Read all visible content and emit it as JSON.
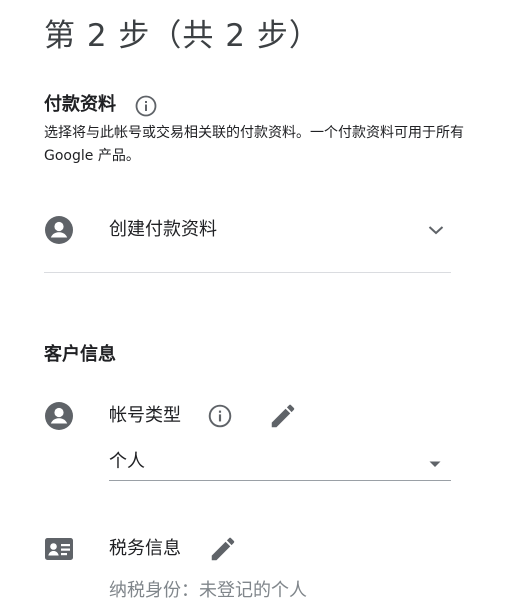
{
  "page": {
    "step_title": "第 2 步（共 2 步）"
  },
  "payment_profile": {
    "title": "付款资料",
    "info_icon": "info-icon",
    "description": "选择将与此帐号或交易相关联的付款资料。一个付款资料可用于所有 Google 产品。",
    "selector": {
      "icon": "account-circle-icon",
      "value": "创建付款资料",
      "dropdown_icon": "chevron-down-icon"
    }
  },
  "customer_info": {
    "title": "客户信息",
    "account_type": {
      "icon": "account-circle-icon",
      "label": "帐号类型",
      "info_icon": "info-icon",
      "edit_icon": "pencil-icon",
      "selected": "个人",
      "dropdown_icon": "arrow-drop-down-icon"
    },
    "tax_info": {
      "icon": "contact-card-icon",
      "label": "税务信息",
      "edit_icon": "pencil-icon",
      "value": "纳税身份：未登记的个人"
    }
  },
  "colors": {
    "icon_gray": "#5f6368",
    "text_primary": "#202124",
    "text_secondary": "#80868b",
    "divider": "#dadce0"
  }
}
